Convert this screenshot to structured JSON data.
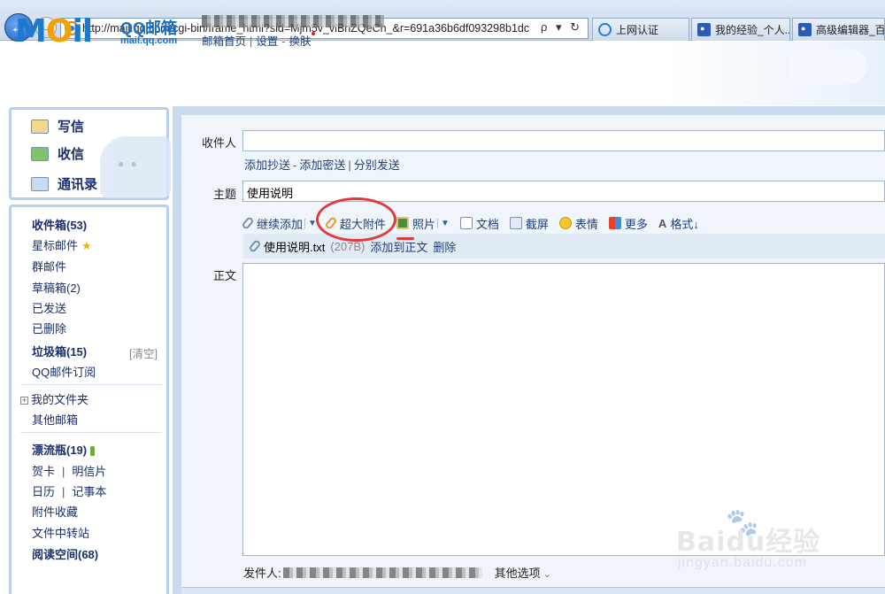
{
  "browser": {
    "url": "http://mail.qq.com/cgi-bin/frame_html?sid=Mjm5v_vlBnZQeCh_&r=691a36b6df093298b1dc",
    "address_tools": "ρ ▾ ↻",
    "tabs": [
      {
        "label": "上网认证",
        "icon": "ie-icon"
      },
      {
        "label": "我的经验_个人...",
        "icon": "paw-icon"
      },
      {
        "label": "高级编辑器_百...",
        "icon": "paw-icon"
      }
    ]
  },
  "header": {
    "logo_text": "MAIL",
    "brand": "QQ邮箱",
    "domain": "mail.qq.com",
    "links": [
      "邮箱首页",
      "设置",
      "换肤"
    ]
  },
  "sidebar": {
    "actions": [
      {
        "label": "写信",
        "icon": "compose-icon"
      },
      {
        "label": "收信",
        "icon": "inbox-icon"
      },
      {
        "label": "通讯录",
        "icon": "contacts-icon"
      }
    ],
    "folders": {
      "inbox": "收件箱(53)",
      "starred": "星标邮件",
      "group": "群邮件",
      "drafts": "草稿箱(2)",
      "sent": "已发送",
      "deleted": "已删除",
      "spam": "垃圾箱(15)",
      "clear": "[清空]",
      "subscriptions": "QQ邮件订阅",
      "my_folders": "我的文件夹",
      "other_mailboxes": "其他邮箱",
      "drift_bottle": "漂流瓶(19)",
      "cards": "贺卡",
      "postcards": "明信片",
      "calendar": "日历",
      "notepad": "记事本",
      "attachment_favorites": "附件收藏",
      "file_transfer": "文件中转站",
      "reading_space": "阅读空间(68)"
    }
  },
  "compose": {
    "to_label": "收件人",
    "to_value": "",
    "cc_links": [
      "添加抄送",
      "添加密送",
      "分别发送"
    ],
    "subject_label": "主题",
    "subject_value": "使用说明",
    "toolbar": {
      "continue_add": "继续添加",
      "large_attachment": "超大附件",
      "photo": "照片",
      "document": "文档",
      "screenshot": "截屏",
      "emoticon": "表情",
      "more": "更多",
      "format": "格式↓"
    },
    "attachment": {
      "name": "使用说明.txt",
      "size": "(207B)",
      "add_to_body": "添加到正文",
      "delete": "删除"
    },
    "body_label": "正文",
    "sender_label": "发件人:",
    "other_options": "其他选项"
  },
  "watermark": {
    "brand": "Baidu经验",
    "site": "jingyan.baidu.com"
  },
  "colors": {
    "link": "#1f3f7a",
    "sidebar_border": "#b7cfeb",
    "frame_bg": "#c9dcef",
    "annotation_red": "#e5383b"
  }
}
